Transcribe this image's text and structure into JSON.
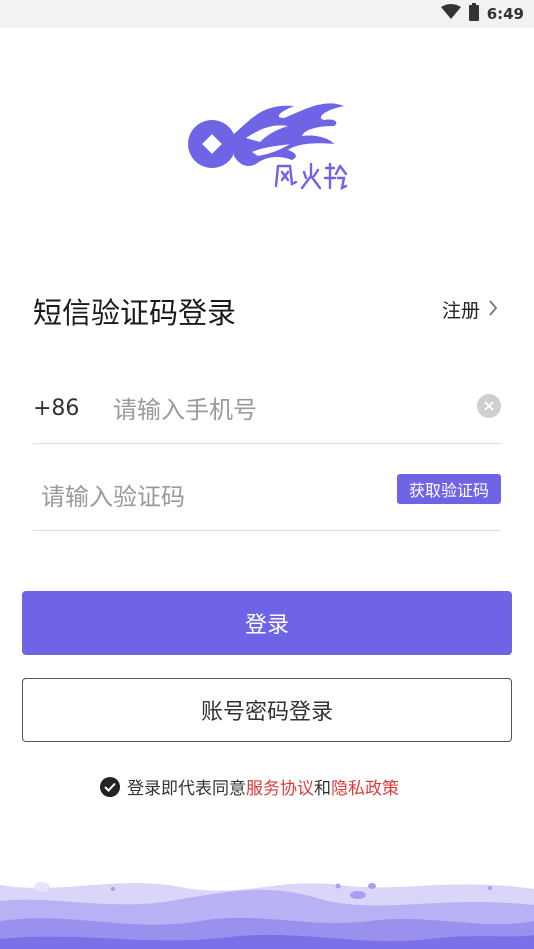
{
  "status_bar": {
    "time": "6:49",
    "icons": [
      "wifi-icon",
      "battery-icon"
    ]
  },
  "logo": {
    "brand_text": "风火轮",
    "accent_color": "#7064e6"
  },
  "header": {
    "title": "短信验证码登录",
    "register_label": "注册"
  },
  "phone": {
    "country_code": "+86",
    "placeholder": "请输入手机号",
    "value": ""
  },
  "code": {
    "placeholder": "请输入验证码",
    "value": "",
    "get_code_label": "获取验证码"
  },
  "buttons": {
    "login_label": "登录",
    "password_login_label": "账号密码登录"
  },
  "agreement": {
    "checked": true,
    "prefix": "登录即代表同意",
    "service_link": "服务协议",
    "connector": "和",
    "privacy_link": "隐私政策",
    "link_color": "#e03a3a"
  },
  "colors": {
    "primary": "#7064e6",
    "wave_light": "#b8b2f4",
    "wave_dark": "#7b70e8"
  }
}
